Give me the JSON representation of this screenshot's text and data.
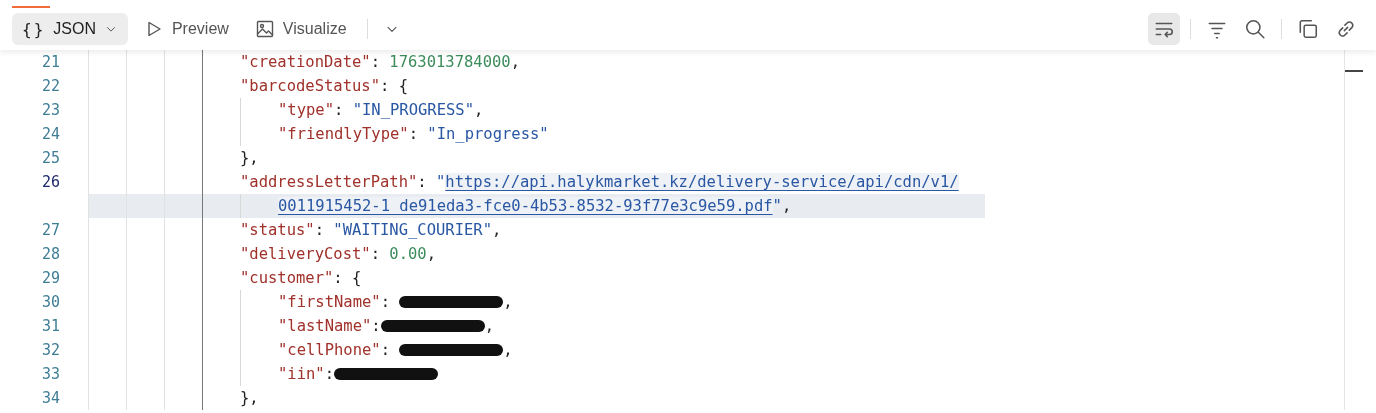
{
  "toolbar": {
    "tabs": [
      {
        "kind": "json",
        "icon_text": "{}",
        "label": "JSON",
        "selected": true,
        "dropdown": true
      },
      {
        "kind": "preview",
        "label": "Preview",
        "selected": false,
        "dropdown": false
      },
      {
        "kind": "visualize",
        "label": "Visualize",
        "selected": false,
        "dropdown": false
      }
    ],
    "actions": [
      {
        "kind": "wrap",
        "on": true
      },
      {
        "kind": "filter",
        "on": false
      },
      {
        "kind": "search",
        "on": false
      },
      {
        "kind": "copy",
        "on": false
      },
      {
        "kind": "link",
        "on": false
      }
    ]
  },
  "editor": {
    "lines": [
      {
        "number": "21",
        "current": false,
        "tokens": [
          {
            "kind": "key",
            "text": "\"creationDate\""
          },
          {
            "kind": "punct",
            "text": ": "
          },
          {
            "kind": "number",
            "text": "1763013784000"
          },
          {
            "kind": "punct",
            "text": ","
          }
        ]
      },
      {
        "number": "22",
        "current": false,
        "tokens": [
          {
            "kind": "key",
            "text": "\"barcodeStatus\""
          },
          {
            "kind": "punct",
            "text": ": {"
          }
        ],
        "children": [
          {
            "number": "23",
            "current": false,
            "tokens": [
              {
                "kind": "key",
                "text": "\"type\""
              },
              {
                "kind": "punct",
                "text": ": "
              },
              {
                "kind": "string",
                "text": "\"IN_PROGRESS\""
              },
              {
                "kind": "punct",
                "text": ","
              }
            ]
          },
          {
            "number": "24",
            "current": false,
            "tokens": [
              {
                "kind": "key",
                "text": "\"friendlyType\""
              },
              {
                "kind": "punct",
                "text": ": "
              },
              {
                "kind": "string",
                "text": "\"In_progress\""
              }
            ]
          }
        ]
      },
      {
        "number": "25",
        "current": false,
        "tokens": [
          {
            "kind": "punct",
            "text": "},"
          }
        ]
      },
      {
        "number": "26",
        "current": true,
        "tokens": [
          {
            "kind": "key",
            "text": "\"addressLetterPath\""
          },
          {
            "kind": "punct",
            "text": ": "
          },
          {
            "kind": "string",
            "text": "\""
          },
          {
            "kind": "link",
            "text": "https://api.halykmarket.kz/delivery-service/api/cdn/v1/"
          }
        ],
        "wrapped": [
          {
            "kind": "link",
            "text": "0011915452-1_de91eda3-fce0-4b53-8532-93f77e3c9e59.pdf"
          },
          {
            "kind": "string",
            "text": "\""
          },
          {
            "kind": "punct",
            "text": ","
          }
        ]
      },
      {
        "number": "27",
        "current": false,
        "tokens": [
          {
            "kind": "key",
            "text": "\"status\""
          },
          {
            "kind": "punct",
            "text": ": "
          },
          {
            "kind": "string",
            "text": "\"WAITING_COURIER\""
          },
          {
            "kind": "punct",
            "text": ","
          }
        ]
      },
      {
        "number": "28",
        "current": false,
        "tokens": [
          {
            "kind": "key",
            "text": "\"deliveryCost\""
          },
          {
            "kind": "punct",
            "text": ": "
          },
          {
            "kind": "number",
            "text": "0.00"
          },
          {
            "kind": "punct",
            "text": ","
          }
        ]
      },
      {
        "number": "29",
        "current": false,
        "tokens": [
          {
            "kind": "key",
            "text": "\"customer\""
          },
          {
            "kind": "punct",
            "text": ": {"
          }
        ],
        "children": [
          {
            "number": "30",
            "current": false,
            "tokens": [
              {
                "kind": "key",
                "text": "\"firstName\""
              },
              {
                "kind": "punct",
                "text": ": "
              },
              {
                "kind": "redacted"
              },
              {
                "kind": "punct",
                "text": ","
              }
            ]
          },
          {
            "number": "31",
            "current": false,
            "tokens": [
              {
                "kind": "key",
                "text": "\"lastName\""
              },
              {
                "kind": "punct",
                "text": ":"
              },
              {
                "kind": "redacted"
              },
              {
                "kind": "punct",
                "text": ","
              }
            ]
          },
          {
            "number": "32",
            "current": false,
            "tokens": [
              {
                "kind": "key",
                "text": "\"cellPhone\""
              },
              {
                "kind": "punct",
                "text": ": "
              },
              {
                "kind": "redacted"
              },
              {
                "kind": "punct",
                "text": ","
              }
            ]
          },
          {
            "number": "33",
            "current": false,
            "tokens": [
              {
                "kind": "key",
                "text": "\"iin\""
              },
              {
                "kind": "punct",
                "text": ":"
              },
              {
                "kind": "redacted"
              }
            ]
          }
        ]
      },
      {
        "number": "34",
        "current": false,
        "tokens": [
          {
            "kind": "punct",
            "text": "},"
          }
        ]
      }
    ]
  }
}
